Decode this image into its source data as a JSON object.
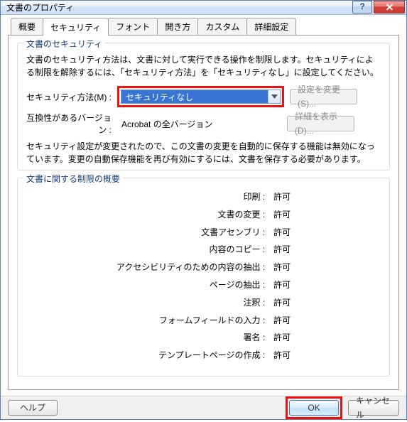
{
  "window": {
    "title": "文書のプロパティ"
  },
  "tabs": {
    "summary": "概要",
    "security": "セキュリティ",
    "font": "フォント",
    "open": "開き方",
    "custom": "カスタム",
    "advanced": "詳細設定"
  },
  "group_security": {
    "title": "文書のセキュリティ",
    "desc": "文書のセキュリティ方法は、文書に対して実行できる操作を制限します。セキュリティによる制限を解除するには、「セキュリティ方法」を「セキュリティなし」に設定してください。",
    "method_label": "セキュリティ方法(M) :",
    "method_value": "セキュリティなし",
    "change_btn": "設定を変更(S)...",
    "compat_label": "互換性があるバージョン :",
    "compat_value": "Acrobat の全バージョン",
    "details_btn": "詳細を表示(D)...",
    "note": "セキュリティ設定が変更されたので、この文書の変更を自動的に保存する機能は無効になっています。変更の自動保存機能を再び有効にするには、文書を保存する必要があります。"
  },
  "group_restrictions": {
    "title": "文書に関する制限の概要",
    "rows": [
      {
        "label": "印刷 :",
        "value": "許可"
      },
      {
        "label": "文書の変更 :",
        "value": "許可"
      },
      {
        "label": "文書アセンブリ :",
        "value": "許可"
      },
      {
        "label": "内容のコピー :",
        "value": "許可"
      },
      {
        "label": "アクセシビリティのための内容の抽出 :",
        "value": "許可"
      },
      {
        "label": "ページの抽出 :",
        "value": "許可"
      },
      {
        "label": "注釈 :",
        "value": "許可"
      },
      {
        "label": "フォームフィールドの入力 :",
        "value": "許可"
      },
      {
        "label": "署名 :",
        "value": "許可"
      },
      {
        "label": "テンプレートページの作成 :",
        "value": "許可"
      }
    ]
  },
  "footer": {
    "help": "ヘルプ",
    "ok": "OK",
    "cancel": "キャンセル"
  }
}
